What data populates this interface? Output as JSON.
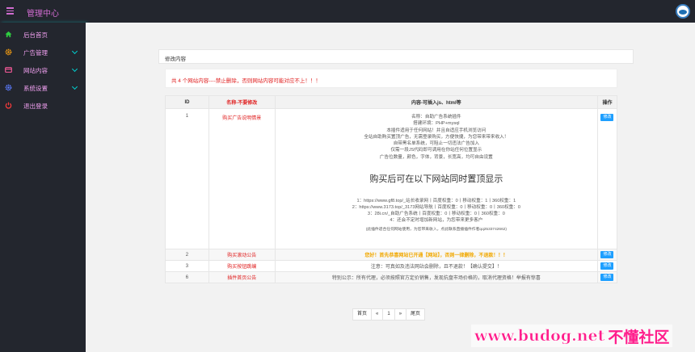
{
  "header": {
    "title": "管理中心",
    "menu_icon": "hamburger-icon",
    "avatar_icon": "logo-avatar-icon"
  },
  "sidebar": {
    "items": [
      {
        "label": "后台首页",
        "icon": "home-icon",
        "color": "#2ecc40",
        "expandable": false
      },
      {
        "label": "广告管理",
        "icon": "gear-icon",
        "color": "#f39c12",
        "expandable": true
      },
      {
        "label": "网站内容",
        "icon": "card-icon",
        "color": "#ff5c9d",
        "expandable": true
      },
      {
        "label": "系统设置",
        "icon": "settings-icon",
        "color": "#5b7bff",
        "expandable": true
      },
      {
        "label": "退出登录",
        "icon": "power-icon",
        "color": "#ff3b3b",
        "expandable": false
      }
    ]
  },
  "panel": {
    "title": "修改内容"
  },
  "notice": "共 4 个网站内容----禁止删除，否则网站内容可能对应不上！！！",
  "table": {
    "headers": {
      "id": "ID",
      "name": "名称-不要修改",
      "content": "内容-可插入js、html等",
      "op": "操作"
    },
    "edit_label": "修改",
    "row1": {
      "id": "1",
      "name": "购买广告说明情景",
      "lines": [
        "名称：自助广告系统插件",
        "搭建环境：PHP+mysql",
        "本插件适用于任何网站！并且自适应手机浏览访问",
        "全站自助购买置顶广告，无需登录购买，方便快捷，为您带来带来收入！",
        "自带黑名单系统，可阻止一切违法广告加入",
        "仅需一段JS代码即可调用在你站任何位置显示",
        "广告位数量，颜色，字体，背景，长宽高，均可自由设置"
      ],
      "big": "购买后可在以下网站同时置顶显示",
      "sites": [
        "1：https://www.gf8.top/_站长收录网丨百度权重：0丨移动权重：1丨360权重：1",
        "2：https://www.3173.top/_3173网站导航丨百度权重：0丨移动权重：0丨360权重：0",
        "3：28i.cn/_自助广告系统丨百度权重：0丨移动权重：0丨360权重：0",
        "4：还会不定时增加新网站，为您带来更多客户"
      ],
      "small": "(此插件适合任何网站使用，为您带来收入，点此联系直播插件作者qq2533742662)"
    },
    "row2": {
      "id": "2",
      "name": "购买滚动公告",
      "content": "您好！首先恭喜网站已开通【网站】，否则一律删除，不退款！！！"
    },
    "row3": {
      "id": "3",
      "name": "购买按钮跳编",
      "content": "注意：可真如及违法网站会删除，且不退款！【确认提交】！"
    },
    "row4": {
      "id": "6",
      "name": "插件首页公告",
      "content": "特别公示：所有代理，必须按照官方定价销售，发现抗盘市场价格的，取消代理资格！举报有惊喜"
    }
  },
  "pager": {
    "first": "首页",
    "prev": "«",
    "page": "1",
    "next": "»",
    "last": "尾页"
  },
  "watermark": {
    "url": "www.budog.net",
    "cn": "不懂社区"
  }
}
